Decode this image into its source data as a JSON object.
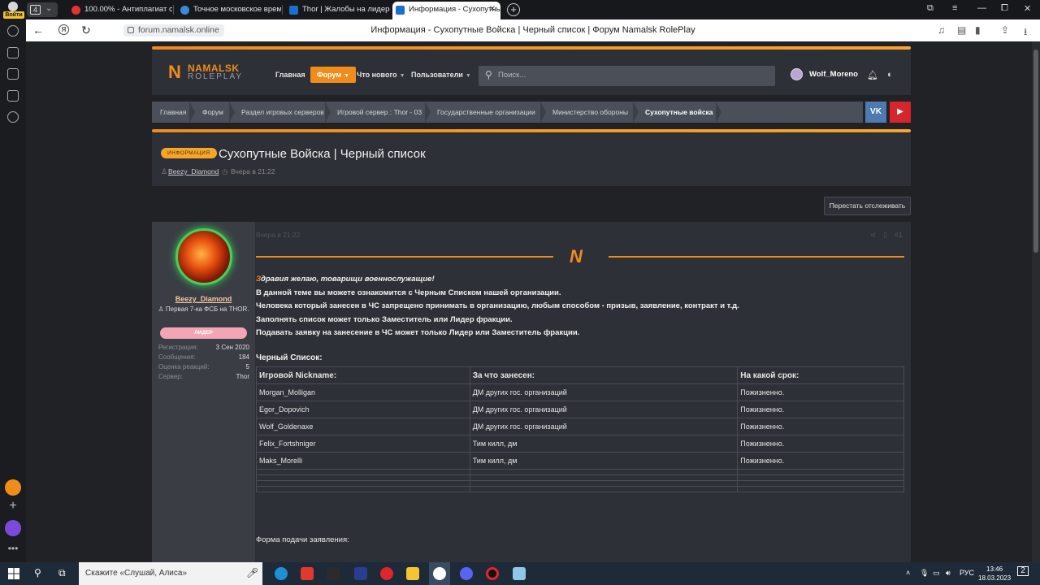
{
  "browser": {
    "login_label": "Войти",
    "tab_count": "4",
    "tabs": [
      {
        "title": "100.00% - Антиплагиат он",
        "color": "#e3342f"
      },
      {
        "title": "Точное московское время",
        "color": "#3b8ad9"
      },
      {
        "title": "Thor | Жалобы на лидеров",
        "color": "#1a6fd1"
      },
      {
        "title": "Информация - Сухопутные",
        "color": "#1a6fd1"
      }
    ],
    "url": "forum.namalsk.online",
    "page_title": "Информация - Сухопутные Войска | Черный список | Форум Namalsk RolePlay"
  },
  "site": {
    "logo_top": "NAMALSK",
    "logo_bottom": "ROLEPLAY",
    "nav": [
      {
        "label": "Главная",
        "active": false
      },
      {
        "label": "Форум",
        "active": true
      },
      {
        "label": "Что нового",
        "active": false
      },
      {
        "label": "Пользователи",
        "active": false
      }
    ],
    "search_placeholder": "Поиск...",
    "username": "Wolf_Moreno",
    "breadcrumbs": [
      "Главная",
      "Форум",
      "Раздел игровых серверов",
      "Игровой сервер : Thor - 03",
      "Государственные организации",
      "Министерство обороны",
      "Сухопутные войска"
    ],
    "social": {
      "vk": "VK",
      "youtube": "▶",
      "vk_color": "#4f7ab0",
      "yt_color": "#d6252b"
    }
  },
  "thread": {
    "prefix": "Информация",
    "title": "Сухопутные Войска | Черный список",
    "author": "Beezy_Diamond",
    "date": "Вчера в 21:22",
    "unwatch_label": "Перестать отслеживать"
  },
  "post": {
    "author": {
      "name": "Beezy_Diamond",
      "title": "Первая 7-ка ФСБ на THOR.",
      "badge": "ЛИДЕР",
      "stats": [
        {
          "k": "Регистрация:",
          "v": "3 Сен 2020"
        },
        {
          "k": "Сообщения:",
          "v": "184"
        },
        {
          "k": "Оценка реакций:",
          "v": "5"
        },
        {
          "k": "Сервер:",
          "v": "Thor"
        }
      ]
    },
    "date": "Вчера в 21:22",
    "post_number": "#1",
    "greeting_first": "З",
    "greeting_rest": "дравия желаю, товарищи военнослужащие!",
    "lines": [
      "В данной теме вы можете ознакомится с Черным Списком нашей организации.",
      "Человека который занесен в ЧС запрещено принимать в организацию, любым способом - призыв, заявление, контракт и т.д.",
      "Заполнять список может только Заместитель или Лидер фракции.",
      "Подавать заявку на занесение в ЧС может только Лидер или Заместитель фракции."
    ],
    "list_heading": "Черный Список:",
    "table": {
      "headers": [
        "Игровой Nickname:",
        "За что занесен:",
        "На какой срок:"
      ],
      "rows": [
        [
          "Morgan_Molligan",
          "ДМ других гос. организаций",
          "Пожизненно."
        ],
        [
          "Egor_Dopovich",
          "ДМ других гос. организаций",
          "Пожизненно."
        ],
        [
          "Wolf_Goldenaxe",
          "ДМ других гос. организаций",
          "Пожизненно."
        ],
        [
          "Felix_Fortshniger",
          "Тим килл, дм",
          "Пожизненно."
        ],
        [
          "Maks_Morelli",
          "Тим килл, дм",
          "Пожизненно."
        ]
      ]
    },
    "form_label": "Форма подачи заявления:"
  },
  "taskbar": {
    "search_placeholder": "Скажите «Слушай, Алиса»",
    "lang": "РУС",
    "time": "13:46",
    "date": "18.03.2023",
    "notifications": "2"
  }
}
